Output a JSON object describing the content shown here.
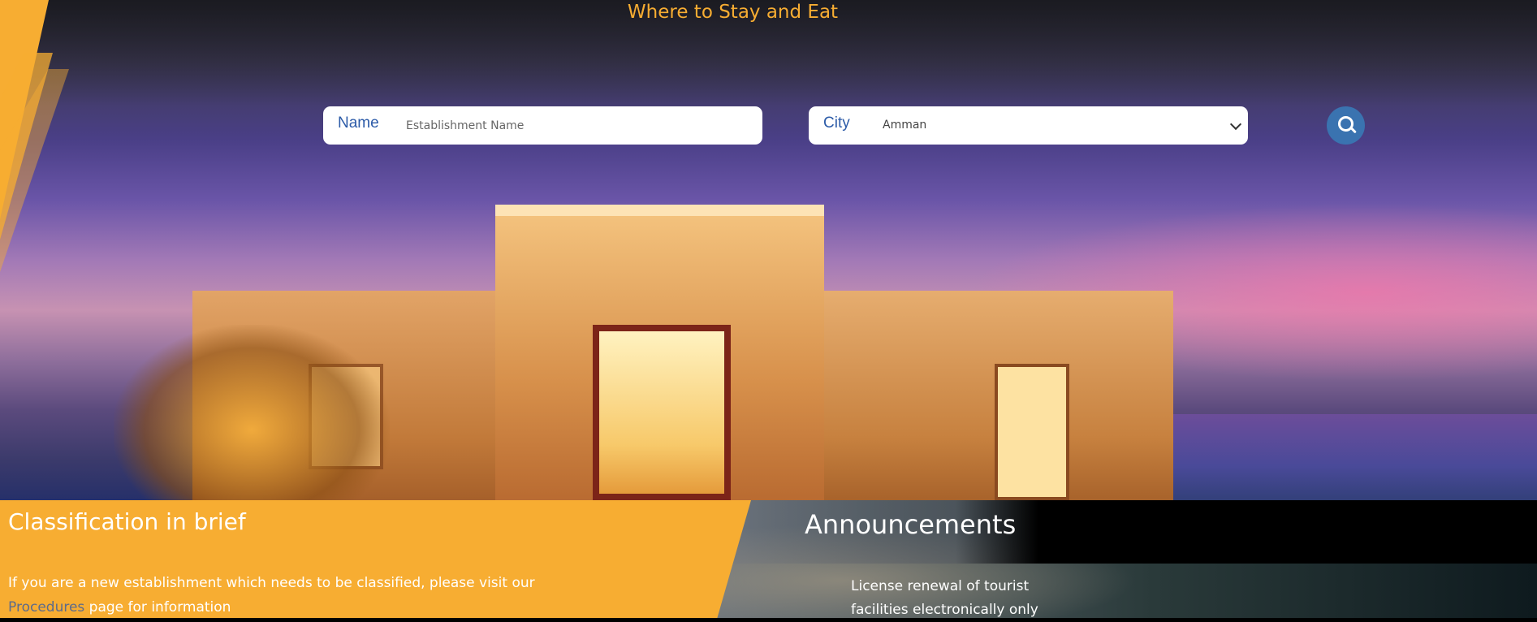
{
  "hero": {
    "title": "Where to Stay and Eat"
  },
  "search": {
    "name_label": "Name",
    "name_placeholder": "Establishment Name",
    "name_value": "",
    "city_label": "City",
    "city_selected": "Amman",
    "search_icon": "search-icon"
  },
  "classification": {
    "title": "Classification in brief",
    "text_before": "If you are a new establishment which needs to be classified, please visit our ",
    "link_text": "Procedures",
    "text_after": " page for information"
  },
  "announcements": {
    "title": "Announcements",
    "items": [
      {
        "text": "License renewal of tourist facilities electronically only"
      }
    ]
  },
  "colors": {
    "accent": "#f7ad32",
    "label_blue": "#2c5ba8",
    "button_blue": "#3a73b0"
  }
}
